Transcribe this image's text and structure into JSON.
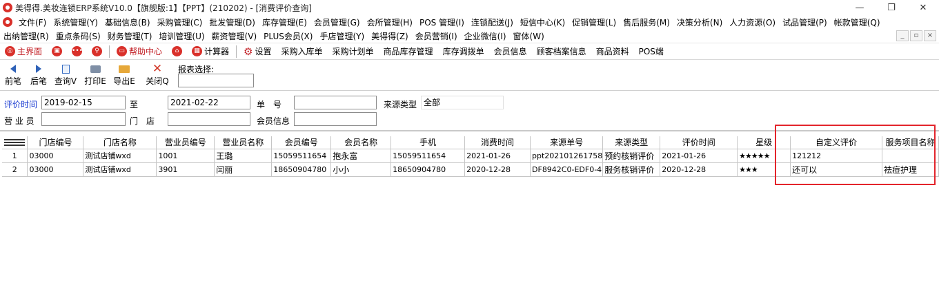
{
  "window": {
    "title": "美得得.美妆连锁ERP系统V10.0【旗舰版:1】【PPT】(210202) - [消费评价查询]",
    "controls": [
      "—",
      "❐",
      "✕"
    ]
  },
  "menu": {
    "row1": [
      "文件(F)",
      "系统管理(Y)",
      "基础信息(B)",
      "采购管理(C)",
      "批发管理(D)",
      "库存管理(E)",
      "会员管理(G)",
      "会所管理(H)",
      "POS 管理(I)",
      "连锁配送(J)",
      "短信中心(K)",
      "促销管理(L)",
      "售后服务(M)",
      "决策分析(N)",
      "人力资源(O)",
      "试品管理(P)",
      "帐款管理(Q)"
    ],
    "row2": [
      "出纳管理(R)",
      "重点条码(S)",
      "财务管理(T)",
      "培训管理(U)",
      "薪资管理(V)",
      "PLUS会员(X)",
      "手店管理(Y)",
      "美得得(Z)",
      "会员营销(I)",
      "企业微信(I)",
      "窗体(W)"
    ],
    "mdi_controls": [
      "_",
      "▫",
      "×"
    ]
  },
  "quickbar": {
    "main": "主界面",
    "help": "帮助中心",
    "calculator": "计算器",
    "settings": "设置",
    "links": [
      "采购入库单",
      "采购计划单",
      "商品库存管理",
      "库存调拨单",
      "会员信息",
      "顾客档案信息",
      "商品资料",
      "POS端"
    ]
  },
  "actions": {
    "prev": "前笔",
    "next": "后笔",
    "query": "查询V",
    "print": "打印E",
    "export": "导出E",
    "close": "关闭Q",
    "report_label": "报表选择:"
  },
  "filters": {
    "eval_time_label": "评价时间",
    "date_from": "2019-02-15",
    "to_label": "至",
    "date_to": "2021-02-22",
    "order_no_label": "单　号",
    "order_no": "",
    "source_type_label": "来源类型",
    "source_type": "全部",
    "salesperson_label": "营 业 员",
    "salesperson": "",
    "store_label": "门　店",
    "store": "",
    "member_label": "会员信息",
    "member": ""
  },
  "grid": {
    "columns": [
      "门店编号",
      "门店名称",
      "营业员编号",
      "营业员名称",
      "会员编号",
      "会员名称",
      "手机",
      "消费时间",
      "来源单号",
      "来源类型",
      "评价时间",
      "星级",
      "自定义评价",
      "服务项目名称"
    ],
    "rows": [
      {
        "idx": "1",
        "store_no": "03000",
        "store_name": "测试店铺wxd",
        "staff_no": "1001",
        "staff_name": "王璐",
        "member_no": "15059511654",
        "member_name": "抱永富",
        "phone": "15059511654",
        "consume_time": "2021-01-26",
        "source_no": "ppt202101261758",
        "source_type": "预约核销评价",
        "eval_time": "2021-01-26",
        "stars": "★★★★★",
        "custom_eval": "121212",
        "service": ""
      },
      {
        "idx": "2",
        "store_no": "03000",
        "store_name": "测试店铺wxd",
        "staff_no": "3901",
        "staff_name": "闫丽",
        "member_no": "18650904780",
        "member_name": "小小",
        "phone": "18650904780",
        "consume_time": "2020-12-28",
        "source_no": "DF8942C0-EDF0-4",
        "source_type": "服务核销评价",
        "eval_time": "2020-12-28",
        "stars": "★★★",
        "custom_eval": "还可以",
        "service": "祛痘护理"
      }
    ]
  },
  "colors": {
    "brand_red": "#d9302a",
    "highlight_border": "#e3242b",
    "filter_label_blue": "#1a3bd1"
  }
}
